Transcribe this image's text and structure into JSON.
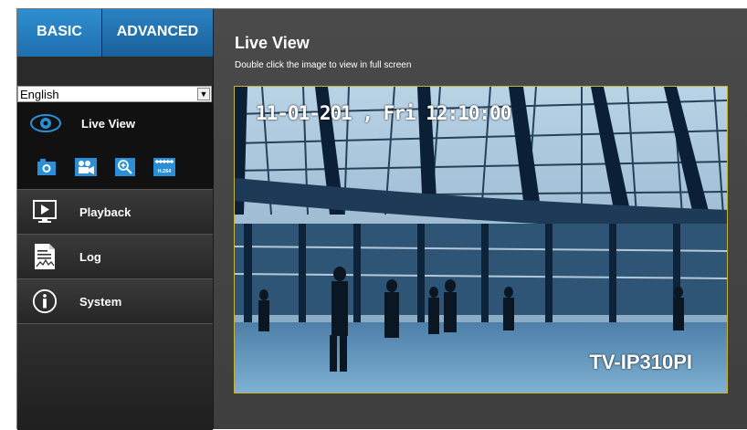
{
  "tabs": {
    "basic": "BASIC",
    "advanced": "ADVANCED"
  },
  "language": {
    "selected": "English"
  },
  "sidebar": {
    "live_view": "Live View",
    "tools": [
      {
        "icon": "snapshot-icon"
      },
      {
        "icon": "record-icon"
      },
      {
        "icon": "zoom-icon"
      },
      {
        "icon": "codec-h264-icon",
        "label": "H.264"
      }
    ],
    "items": [
      {
        "label": "Playback",
        "icon": "playback-icon"
      },
      {
        "label": "Log",
        "icon": "log-icon"
      },
      {
        "label": "System",
        "icon": "info-icon"
      }
    ]
  },
  "main": {
    "title": "Live View",
    "subtitle": "Double click the image to view in full screen",
    "timestamp": "11-01-201 , Fri 12:10:00",
    "camera_label": "TV-IP310PI"
  },
  "colors": {
    "accent": "#2a87c8",
    "video_border": "#c9b23a",
    "icon_blue": "#2a8fd8"
  }
}
